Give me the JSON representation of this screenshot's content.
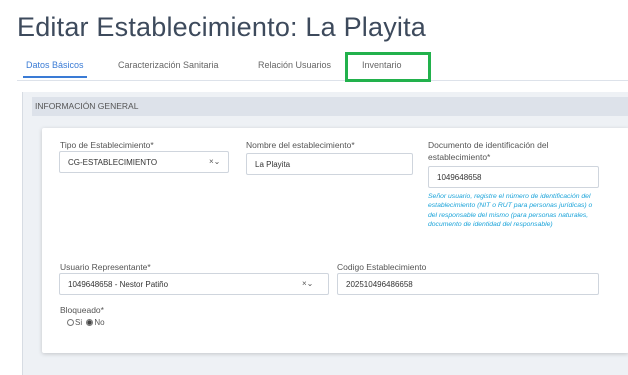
{
  "page": {
    "title": "Editar Establecimiento: La Playita"
  },
  "tabs": [
    {
      "label": "Datos Básicos",
      "active": true
    },
    {
      "label": "Caracterización Sanitaria",
      "active": false
    },
    {
      "label": "Relación Usuarios",
      "active": false
    },
    {
      "label": "Inventario",
      "active": false,
      "highlighted": true
    }
  ],
  "section": {
    "title": "INFORMACIÓN GENERAL"
  },
  "form": {
    "tipo": {
      "label": "Tipo de Establecimiento*",
      "value": "CG-ESTABLECIMIENTO",
      "clear": "×⌄"
    },
    "nombre": {
      "label": "Nombre del establecimiento*",
      "value": "La Playita"
    },
    "documento": {
      "label_line1": "Documento de identificación del",
      "label_line2": "establecimiento*",
      "value": "1049648658",
      "help": "Señor usuario, registre el número de identificación del establecimiento (NIT o RUT para personas jurídicas) o del responsable del mismo (para personas naturales, documento de identidad del responsable)"
    },
    "usuario": {
      "label": "Usuario Representante*",
      "value": "1049648658 - Nestor Patiño",
      "clear": "×⌄"
    },
    "codigo": {
      "label": "Codigo Establecimiento",
      "value": "202510496486658"
    },
    "bloqueado": {
      "label": "Bloqueado*",
      "option_si": "Si",
      "option_no": "No",
      "selected": "No"
    }
  },
  "colors": {
    "accent": "#3a7bd5",
    "highlight": "#22b14c",
    "help_text": "#1aa3d9"
  }
}
